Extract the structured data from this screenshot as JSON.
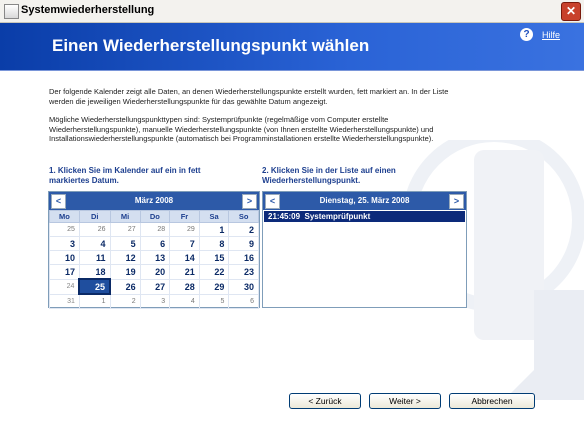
{
  "window": {
    "title": "Systemwiederherstellung",
    "close_label": "✕"
  },
  "header": {
    "title": "Einen Wiederherstellungspunkt wählen",
    "help_icon": "?",
    "help_label": "Hilfe"
  },
  "intro": {
    "p1": "Der folgende Kalender zeigt alle Daten, an denen Wiederherstellungspunkte erstellt wurden, fett markiert an. In der Liste werden die jeweiligen Wiederherstellungspunkte für das gewählte Datum angezeigt.",
    "p2": "Mögliche Wiederherstellungspunkttypen sind: Systemprüfpunkte (regelmäßige vom Computer erstellte Wiederherstellungspunkte), manuelle Wiederherstellungspunkte (von Ihnen erstellte Wiederherstellungspunkte) und Installationswiederherstellungspunkte (automatisch bei Programminstallationen erstellte Wiederherstellungspunkte)."
  },
  "step1": "1. Klicken Sie im Kalender auf ein in fett markiertes Datum.",
  "step2": "2. Klicken Sie in der Liste auf einen Wiederherstellungspunkt.",
  "calendar": {
    "month": "März 2008",
    "prev": "<",
    "next": ">",
    "weekdays": [
      "Mo",
      "Di",
      "Mi",
      "Do",
      "Fr",
      "Sa",
      "So"
    ],
    "weeks": [
      [
        {
          "d": "25",
          "t": "other"
        },
        {
          "d": "26",
          "t": "other"
        },
        {
          "d": "27",
          "t": "other"
        },
        {
          "d": "28",
          "t": "other"
        },
        {
          "d": "29",
          "t": "other"
        },
        {
          "d": "1",
          "t": "bold"
        },
        {
          "d": "2",
          "t": "bold"
        }
      ],
      [
        {
          "d": "3",
          "t": "bold"
        },
        {
          "d": "4",
          "t": "bold"
        },
        {
          "d": "5",
          "t": "bold"
        },
        {
          "d": "6",
          "t": "bold"
        },
        {
          "d": "7",
          "t": "bold"
        },
        {
          "d": "8",
          "t": "bold"
        },
        {
          "d": "9",
          "t": "bold"
        }
      ],
      [
        {
          "d": "10",
          "t": "bold"
        },
        {
          "d": "11",
          "t": "bold"
        },
        {
          "d": "12",
          "t": "bold"
        },
        {
          "d": "13",
          "t": "bold"
        },
        {
          "d": "14",
          "t": "bold"
        },
        {
          "d": "15",
          "t": "bold"
        },
        {
          "d": "16",
          "t": "bold"
        }
      ],
      [
        {
          "d": "17",
          "t": "bold"
        },
        {
          "d": "18",
          "t": "bold"
        },
        {
          "d": "19",
          "t": "bold"
        },
        {
          "d": "20",
          "t": "bold"
        },
        {
          "d": "21",
          "t": "bold"
        },
        {
          "d": "22",
          "t": "bold"
        },
        {
          "d": "23",
          "t": "bold"
        }
      ],
      [
        {
          "d": "24",
          "t": "normal"
        },
        {
          "d": "25",
          "t": "sel"
        },
        {
          "d": "26",
          "t": "bold"
        },
        {
          "d": "27",
          "t": "bold"
        },
        {
          "d": "28",
          "t": "bold"
        },
        {
          "d": "29",
          "t": "bold"
        },
        {
          "d": "30",
          "t": "bold"
        }
      ],
      [
        {
          "d": "31",
          "t": "normal"
        },
        {
          "d": "1",
          "t": "other"
        },
        {
          "d": "2",
          "t": "other"
        },
        {
          "d": "3",
          "t": "other"
        },
        {
          "d": "4",
          "t": "other"
        },
        {
          "d": "5",
          "t": "other"
        },
        {
          "d": "6",
          "t": "other"
        }
      ]
    ]
  },
  "restore_list": {
    "date": "Dienstag, 25. März 2008",
    "prev": "<",
    "next": ">",
    "items": [
      {
        "time": "21:45:09",
        "label": "Systemprüfpunkt"
      }
    ]
  },
  "buttons": {
    "back": "< Zurück",
    "next": "Weiter >",
    "cancel": "Abbrechen"
  }
}
